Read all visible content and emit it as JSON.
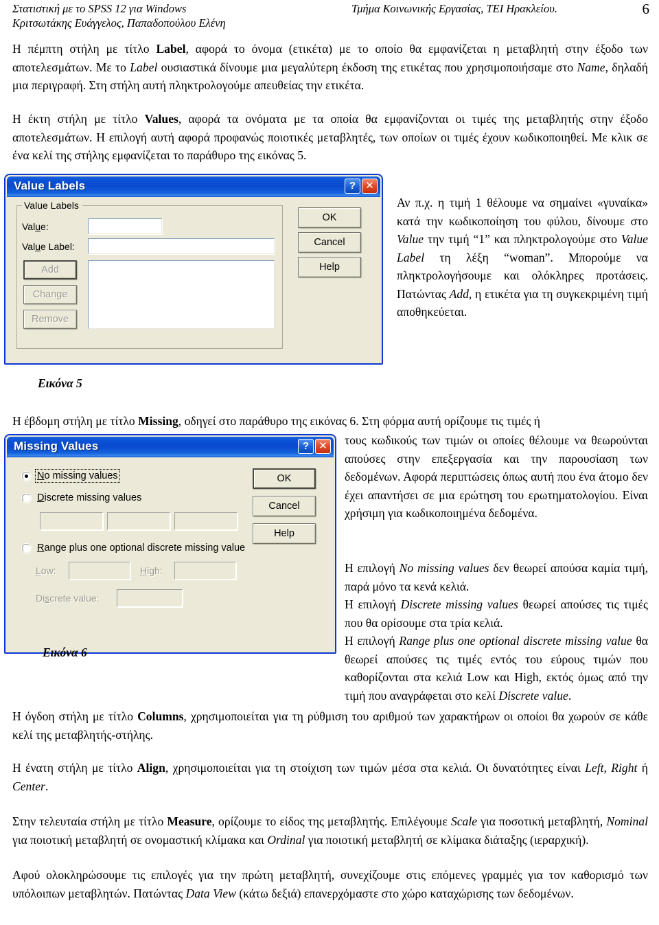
{
  "header": {
    "left_line1": "Στατιστική με το SPSS 12  για Windows",
    "left_line2": "Κριτσωτάκης Ευάγγελος, Παπαδοπούλου Ελένη",
    "right": "Τμήμα Κοινωνικής Εργασίας, ΤΕΙ Ηρακλείου.",
    "page_number": "6"
  },
  "body": {
    "para_label_1": "Η πέμπτη στήλη με τίτλο ",
    "para_label_bold": "Label",
    "para_label_2": ", αφορά το όνομα (ετικέτα) με το οποίο θα εμφανίζεται η μεταβλητή στην έξοδο των αποτελεσμάτων. Με το ",
    "para_label_it1": "Label",
    "para_label_3": " ουσιαστικά δίνουμε μια μεγαλύτερη έκδοση της ετικέτας που χρησιμοποιήσαμε στο ",
    "para_label_it2": "Name",
    "para_label_4": ", δηλαδή μια περιγραφή. Στη στήλη αυτή πληκτρολογούμε απευθείας την ετικέτα.",
    "para_values_1": "Η έκτη στήλη με τίτλο ",
    "para_values_bold": "Values",
    "para_values_2": ", αφορά τα ονόματα με τα οποία θα εμφανίζονται οι τιμές της μεταβλητής στην έξοδο αποτελεσμάτων. Η επιλογή αυτή αφορά προφανώς ποιοτικές μεταβλητές, των οποίων οι τιμές έχουν κωδικοποιηθεί. Με κλικ σε ένα κελί της στήλης εμφανίζεται το παράθυρο της εικόνας 5.",
    "side_values_1": "Αν π.χ. η τιμή 1 θέλουμε να σημαίνει «γυναίκα» κατά την κωδικοποίηση του φύλου, δίνουμε στο ",
    "side_values_it1": "Value",
    "side_values_2": " την τιμή “1” και πληκτρολογούμε στο ",
    "side_values_it2": "Value Label",
    "side_values_3": " τη λέξη “woman”. Μπορούμε να πληκτρολογήσουμε και ολόκληρες προτάσεις. Πατώντας ",
    "side_values_it3": "Add",
    "side_values_4": ", η ετικέτα για τη συγκεκριμένη τιμή αποθηκεύεται.",
    "caption5": "Εικόνα 5",
    "caption6": "Εικόνα 6",
    "para_missing_1": "Η έβδομη στήλη με τίτλο ",
    "para_missing_bold": "Missing",
    "para_missing_2": ", οδηγεί στο παράθυρο της εικόνας 6.  Στη φόρμα αυτή ορίζουμε τις τιμές ή",
    "side_missing_1": "τους κωδικούς των τιμών οι οποίες θέλουμε να θεωρούνται απούσες στην επεξεργασία και την παρουσίαση των δεδομένων. Αφορά περιπτώσεις όπως αυτή που ένα άτομο δεν έχει απαντήσει σε μια ερώτηση του ερωτηματολογίου. Είναι χρήσιμη για κωδικοποιημένα δεδομένα.",
    "side_missing_2a": "Η επιλογή ",
    "side_missing_2it": "No missing values",
    "side_missing_2b": " δεν θεωρεί απούσα καμία τιμή, παρά μόνο τα κενά κελιά.",
    "side_missing_3a": "Η επιλογή ",
    "side_missing_3it": "Discrete missing values",
    "side_missing_3b": " θεωρεί απούσες τις τιμές που θα ορίσουμε στα τρία κελιά.",
    "side_missing_4a": "Η επιλογή ",
    "side_missing_4it": "Range plus one optional discrete missing value",
    "side_missing_4b": " θα θεωρεί απούσες τις τιμές εντός του εύρους τιμών που καθορίζονται στα κελιά Low και High, εκτός όμως από την τιμή που αναγράφεται στο κελί ",
    "side_missing_4it2": "Discrete value",
    "side_missing_4c": ".",
    "para_columns_1": "Η όγδοη στήλη με τίτλο ",
    "para_columns_bold": "Columns",
    "para_columns_2": ", χρησιμοποιείται για τη ρύθμιση του αριθμού των χαρακτήρων οι οποίοι θα χωρούν σε κάθε κελί της μεταβλητής-στήλης.",
    "para_align_1": "Η ένατη στήλη με τίτλο ",
    "para_align_bold": "Align",
    "para_align_2": ", χρησιμοποιείται για τη στοίχιση των τιμών μέσα στα κελιά. Οι δυνατότητες είναι ",
    "para_align_it1": "Left, Right",
    "para_align_3": " ή ",
    "para_align_it2": "Center",
    "para_align_4": ".",
    "para_measure_1": "Στην τελευταία στήλη με τίτλο ",
    "para_measure_bold": "Measure",
    "para_measure_2": ", ορίζουμε το είδος της μεταβλητής. Επιλέγουμε ",
    "para_measure_it1": "Scale",
    "para_measure_3": " για ποσοτική μεταβλητή, ",
    "para_measure_it2": "Nominal",
    "para_measure_4": " για ποιοτική μεταβλητή σε ονομαστική κλίμακα και ",
    "para_measure_it3": "Ordinal",
    "para_measure_5": " για ποιοτική μεταβλητή σε κλίμακα διάταξης (ιεραρχική).",
    "para_final_1": "Αφού ολοκληρώσουμε τις επιλογές για την πρώτη μεταβλητή, συνεχίζουμε στις επόμενες γραμμές για τον καθορισμό των υπόλοιπων μεταβλητών. Πατώντας ",
    "para_final_it": "Data View",
    "para_final_2": " (κάτω δεξιά) επανερχόμαστε στο χώρο καταχώρισης των δεδομένων."
  },
  "dialog_value_labels": {
    "title": "Value Labels",
    "help_glyph": "?",
    "close_glyph": "✕",
    "group_legend": "Value Labels",
    "value_label": "Value:",
    "value_input": "",
    "value_label_label": "Value Label:",
    "value_label_input": "",
    "add_button": "Add",
    "change_button": "Change",
    "remove_button": "Remove",
    "ok_button": "OK",
    "cancel_button": "Cancel",
    "help_button": "Help",
    "list_items": []
  },
  "dialog_missing_values": {
    "title": "Missing Values",
    "help_glyph": "?",
    "close_glyph": "✕",
    "radio_no_missing": "No missing values",
    "radio_discrete": "Discrete missing values",
    "radio_range": "Range plus one optional discrete missing value",
    "discrete_field_1": "",
    "discrete_field_2": "",
    "discrete_field_3": "",
    "low_label": "Low:",
    "low_value": "",
    "high_label": "High:",
    "high_value": "",
    "discrete_value_label": "Discrete value:",
    "discrete_value": "",
    "ok_button": "OK",
    "cancel_button": "Cancel",
    "help_button": "Help",
    "selected_radio": "No missing values"
  },
  "colors": {
    "titlebar_blue": "#0a4bcf",
    "dialog_face": "#ece9d8",
    "close_red": "#c22f10",
    "border_blue": "#0831d9"
  }
}
